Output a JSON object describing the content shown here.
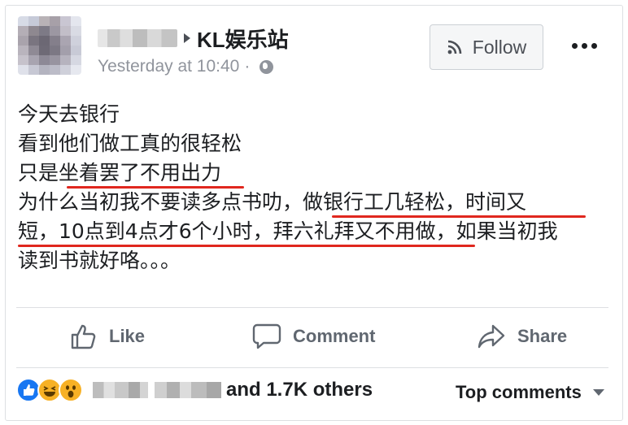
{
  "post": {
    "page_name": "KL娱乐站",
    "timestamp": "Yesterday at 10:40",
    "separator": "·",
    "privacy_icon": "globe-icon",
    "follow_label": "Follow",
    "more_icon": "more-options-icon",
    "lines": [
      "今天去银行",
      "看到他们做工真的很轻松",
      "只是坐着罢了不用出力",
      "为什么当初我不要读多点书叻，做银行工几轻松，时间又",
      "短，10点到4点才6个小时，拜六礼拜又不用做，如果当初我",
      "读到书就好咯。。。"
    ],
    "underline_color": "#e0271e"
  },
  "actions": {
    "like_label": "Like",
    "comment_label": "Comment",
    "share_label": "Share"
  },
  "reactions": {
    "icons": [
      "like-reaction-icon",
      "haha-reaction-icon",
      "wow-reaction-icon"
    ],
    "others_label": "and 1.7K others",
    "sort_label": "Top comments"
  }
}
